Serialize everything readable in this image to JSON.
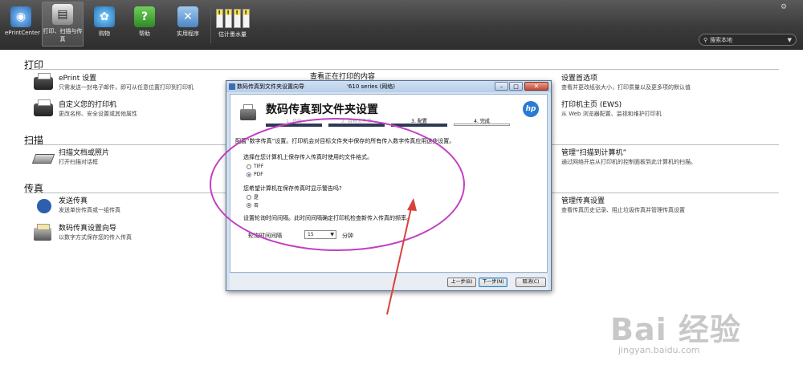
{
  "toolbar": {
    "buttons": [
      {
        "label": "ePrintCenter",
        "icon": "eprint-icon"
      },
      {
        "label": "打印、扫描与传真",
        "icon": "printer-icon"
      },
      {
        "label": "购物",
        "icon": "shopping-icon"
      },
      {
        "label": "帮助",
        "icon": "help-icon"
      },
      {
        "label": "实用程序",
        "icon": "tools-icon"
      }
    ],
    "ink_label": "估计墨水量",
    "search_placeholder": "搜索本地"
  },
  "sections": {
    "print": "打印",
    "scan": "扫描",
    "fax": "传真"
  },
  "items": {
    "eprint": {
      "title": "ePrint 设置",
      "desc": "只需发送一封电子邮件，即可从任意位置打印到打印机"
    },
    "custom_printer": {
      "title": "自定义您的打印机",
      "desc": "更改名称、安全设置或其他属性"
    },
    "view_printing": {
      "title": "查看正在打印的内容"
    },
    "preferences": {
      "title": "设置首选项",
      "desc": "查看并更改纸张大小，打印质量以及更多项的默认值"
    },
    "printer_home": {
      "title": "打印机主页 (EWS)",
      "desc": "从 Web 浏览器配置、监视和维护打印机"
    },
    "scan_doc": {
      "title": "扫描文档或照片",
      "desc": "打开扫描对话框"
    },
    "scan_to_pc": {
      "title": "管理“扫描到计算机”",
      "desc": "通过网络开启从打印机的控制面板到此计算机的扫描。"
    },
    "send_fax": {
      "title": "发送传真",
      "desc": "发送单份传真或一组传真"
    },
    "digital_fax": {
      "title": "数码传真设置向导",
      "desc": "以数字方式保存您的传入传真"
    },
    "manage_fax": {
      "title": "管理传真设置",
      "desc": "查看传真历史记录、阻止垃圾传真并管理传真设置"
    }
  },
  "dialog": {
    "title": "数码传真到文件夹设置向导",
    "title_tail": "'610 series (网络)",
    "heading": "数码传真到文件夹设置",
    "steps": [
      {
        "num": "1.",
        "label": "开始"
      },
      {
        "num": "2.",
        "label": "目标文件夹"
      },
      {
        "num": "3.",
        "label": "配置"
      },
      {
        "num": "4.",
        "label": "完成"
      }
    ],
    "intro": "配置“数字传真”设置。打印机会对目标文件夹中保存的所有传入数字传真应用这些设置。",
    "q_format": "选择在您计算机上保存传入传真时使用的文件格式。",
    "format_options": [
      "TIFF",
      "PDF"
    ],
    "q_notify": "您希望计算机在保存传真时显示警告吗?",
    "notify_options": [
      "是",
      "否"
    ],
    "q_poll": "设置轮询时间间隔。此时间间隔确定打印机检查新传入传真的频率。",
    "poll_label": "轮询时间间隔",
    "poll_value": "15",
    "poll_unit": "分钟",
    "btn_back": "上一步(B)",
    "btn_next": "下一步(N)",
    "btn_cancel": "取消(C)"
  },
  "annotation": {
    "ellipse_color": "#c23fc2",
    "arrow_color": "#d9423a"
  },
  "watermark": {
    "main": "Bai 经验",
    "sub": "jingyan.baidu.com"
  }
}
